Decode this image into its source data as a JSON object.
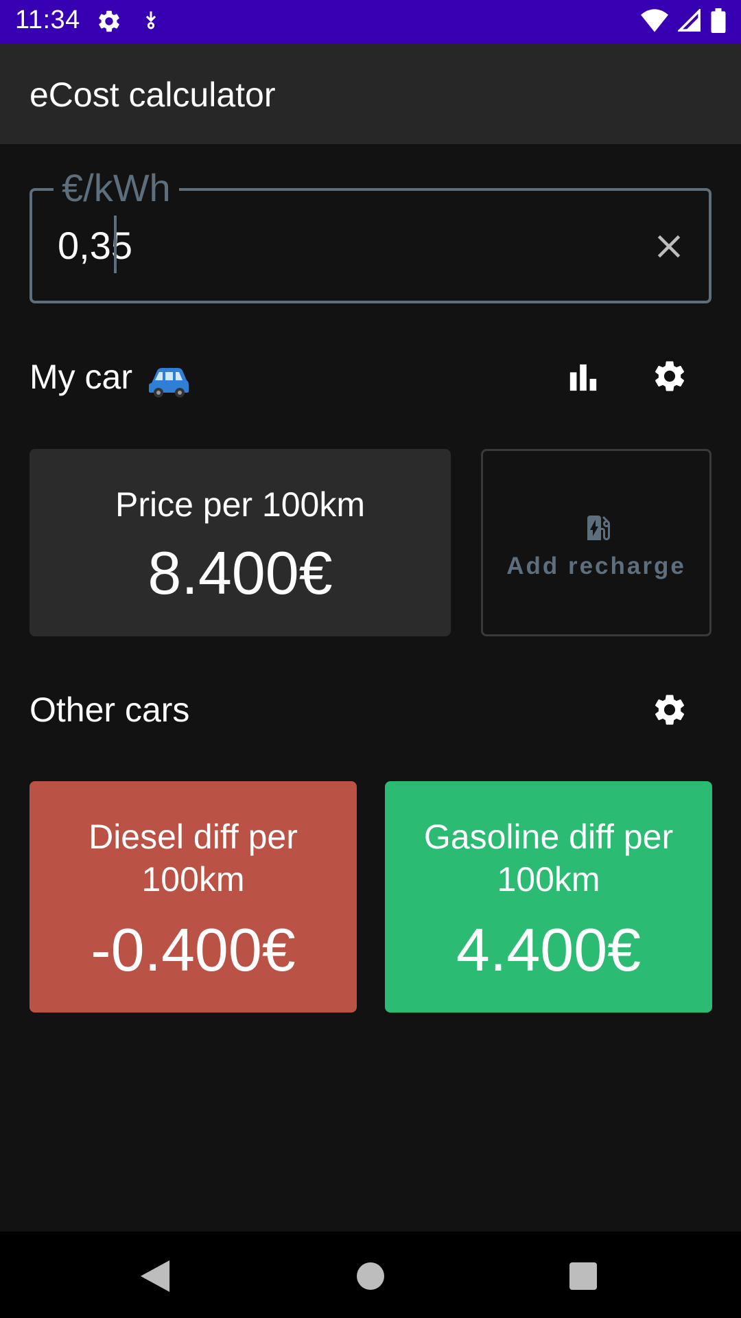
{
  "status_bar": {
    "time": "11:34",
    "icons": [
      "gear-icon",
      "download-icon",
      "wifi-icon",
      "signal-icon",
      "battery-icon"
    ]
  },
  "app_bar": {
    "title": "eCost calculator"
  },
  "price_input": {
    "label": "€/kWh",
    "value": "0,35",
    "clear_icon": "close-icon"
  },
  "my_car": {
    "title": "My car",
    "emoji": "🚙",
    "stats_icon": "bar-chart-icon",
    "settings_icon": "gear-icon",
    "price_card": {
      "label": "Price per 100km",
      "value": "8.400€"
    },
    "recharge_button": {
      "label": "Add recharge",
      "icon": "ev-station-icon"
    }
  },
  "other_cars": {
    "title": "Other cars",
    "settings_icon": "gear-icon",
    "diesel": {
      "label": "Diesel diff per 100km",
      "value": "-0.400€",
      "color": "#bb5246"
    },
    "gasoline": {
      "label": "Gasoline diff per 100km",
      "value": "4.400€",
      "color": "#2bbb73"
    }
  },
  "nav_bar": {
    "back_icon": "back-triangle-icon",
    "home_icon": "home-circle-icon",
    "recents_icon": "recents-square-icon"
  }
}
